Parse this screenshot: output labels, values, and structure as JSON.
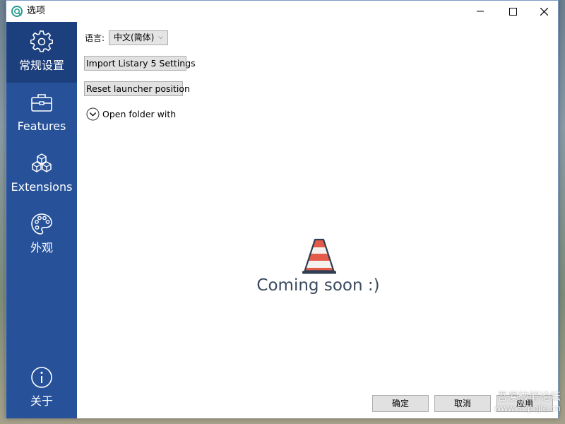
{
  "window": {
    "title": "选项"
  },
  "sidebar": {
    "items": [
      {
        "label": "常规设置",
        "icon": "gear-icon",
        "active": true
      },
      {
        "label": "Features",
        "icon": "toolbox-icon",
        "active": false
      },
      {
        "label": "Extensions",
        "icon": "cubes-icon",
        "active": false
      },
      {
        "label": "外观",
        "icon": "palette-icon",
        "active": false
      }
    ],
    "about": {
      "label": "关于",
      "icon": "info-icon"
    }
  },
  "general": {
    "language_label": "语言:",
    "language_value": "中文(简体)",
    "import_button": "Import Listary 5 Settings",
    "reset_button": "Reset launcher position",
    "open_folder_label": "Open folder with"
  },
  "placeholder": {
    "message": "Coming soon :)",
    "icon": "traffic-cone-icon"
  },
  "footer": {
    "ok": "确定",
    "cancel": "取消",
    "apply": "应用"
  },
  "watermark": {
    "line1": "吾爱破解论坛",
    "line2": "www.52pojie.cn"
  },
  "colors": {
    "sidebar_bg": "#27529a",
    "sidebar_active_bg": "#1c3f7d",
    "cone_orange": "#e55b4a"
  }
}
